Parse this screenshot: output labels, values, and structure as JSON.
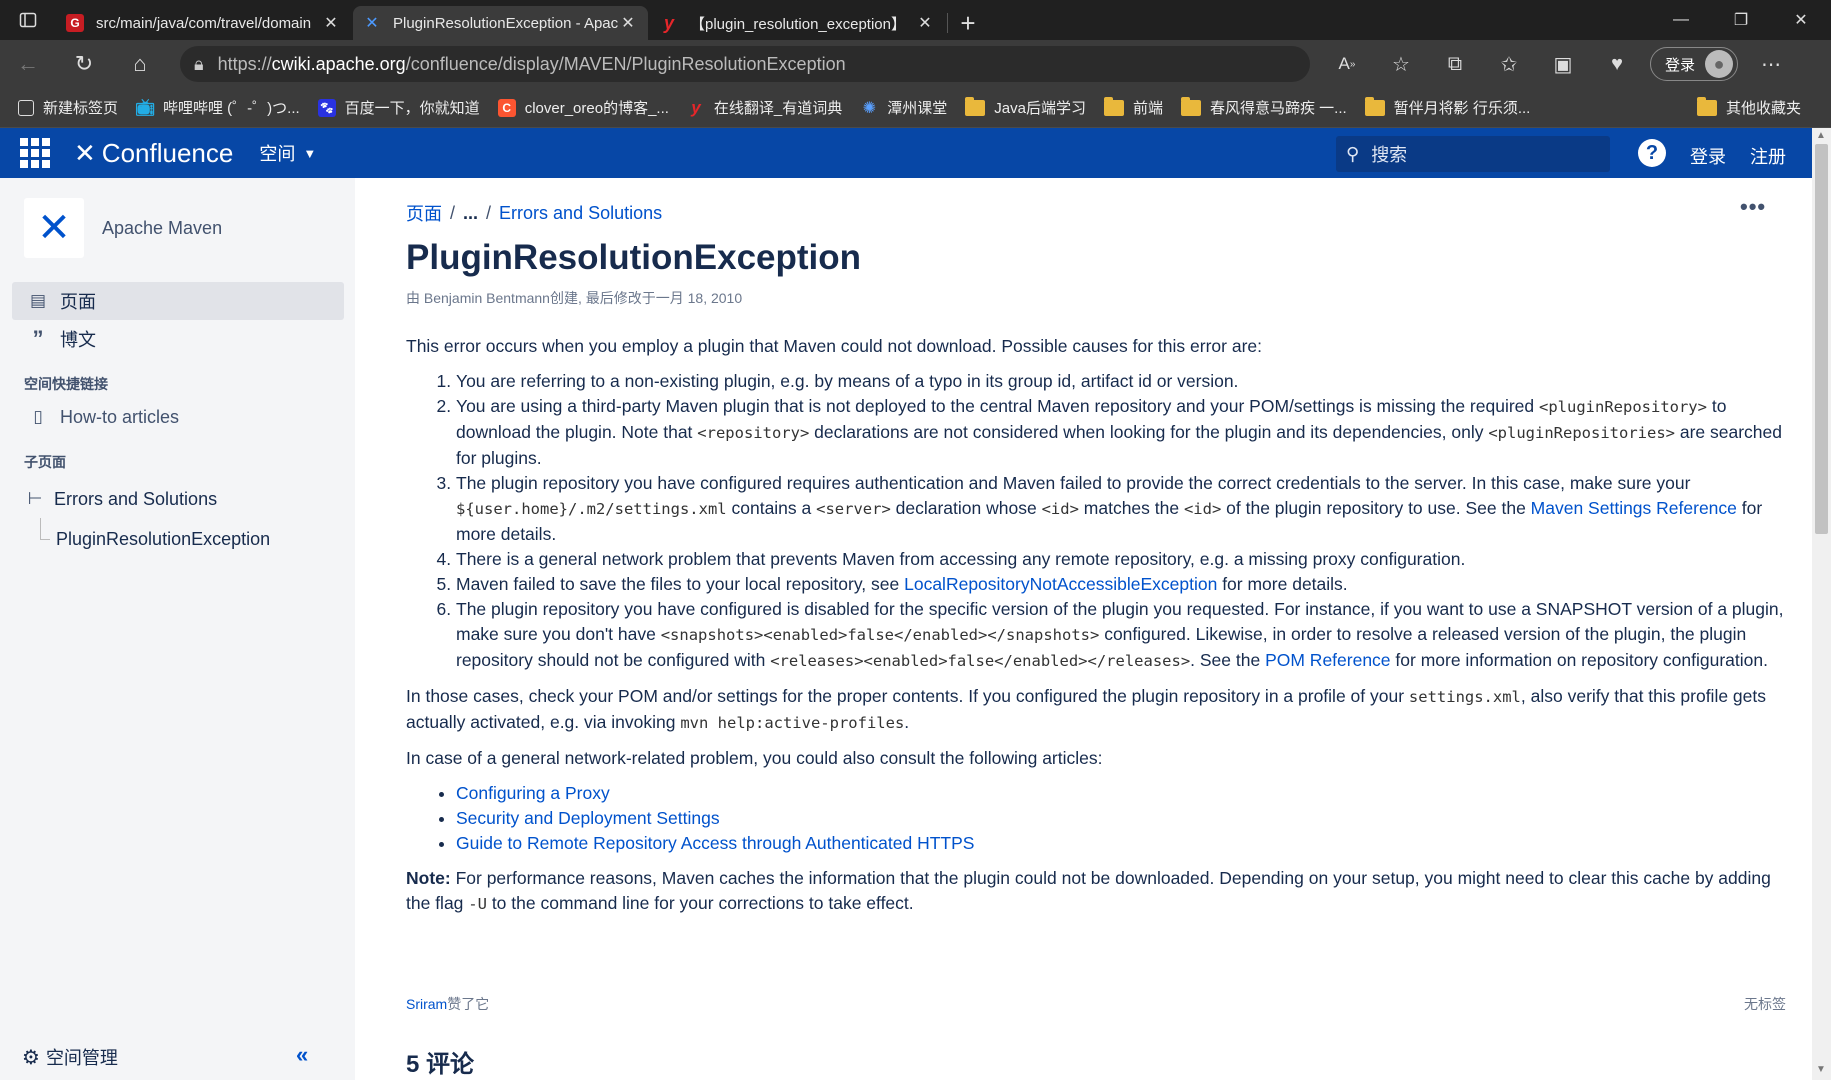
{
  "browser": {
    "tabs": [
      {
        "title": "src/main/java/com/travel/domain",
        "favicon": "G"
      },
      {
        "title": "PluginResolutionException - Apache",
        "favicon": "X"
      },
      {
        "title": "【plugin_resolution_exception】",
        "favicon": "y"
      }
    ],
    "url_prefix": "https://",
    "url_host": "cwiki.apache.org",
    "url_path": "/confluence/display/MAVEN/PluginResolutionException",
    "login_label": "登录",
    "bookmarks": [
      {
        "label": "新建标签页",
        "icon": "newtab-icon"
      },
      {
        "label": "哔哩哔哩 (゜-゜)つ...",
        "icon": "bilibili-icon"
      },
      {
        "label": "百度一下，你就知道",
        "icon": "baidu-icon"
      },
      {
        "label": "clover_oreo的博客_...",
        "icon": "csdn-icon"
      },
      {
        "label": "在线翻译_有道词典",
        "icon": "youdao-icon"
      },
      {
        "label": "潭州课堂",
        "icon": "tanzhou-icon"
      },
      {
        "label": "Java后端学习",
        "icon": "folder-icon"
      },
      {
        "label": "前端",
        "icon": "folder-icon"
      },
      {
        "label": "春风得意马蹄疾 一...",
        "icon": "folder-icon"
      },
      {
        "label": "暂伴月将影 行乐须...",
        "icon": "folder-icon"
      }
    ],
    "other_bookmarks": "其他收藏夹"
  },
  "header": {
    "logo": "Confluence",
    "space_menu": "空间",
    "search_placeholder": "搜索",
    "help": "?",
    "login": "登录",
    "register": "注册"
  },
  "sidebar": {
    "space_name": "Apache Maven",
    "items": [
      {
        "label": "页面"
      },
      {
        "label": "博文"
      }
    ],
    "shortcuts_heading": "空间快捷链接",
    "shortcut": "How-to articles",
    "children_heading": "子页面",
    "tree_parent": "Errors and Solutions",
    "tree_child": "PluginResolutionException",
    "manage": "空间管理"
  },
  "page": {
    "breadcrumb_root": "页面",
    "breadcrumb_ellipsis": "...",
    "breadcrumb_parent": "Errors and Solutions",
    "title": "PluginResolutionException",
    "meta": "由 Benjamin Bentmann创建, 最后修改于一月 18, 2010",
    "intro": "This error occurs when you employ a plugin that Maven could not download. Possible causes for this error are:",
    "causes": {
      "c1": "You are referring to a non-existing plugin, e.g. by means of a typo in its group id, artifact id or version.",
      "c2a": "You are using a third-party Maven plugin that is not deployed to the central Maven repository and your POM/settings is missing the required ",
      "c2code1": "<pluginRepository>",
      "c2b": " to download the plugin. Note that ",
      "c2code2": "<repository>",
      "c2c": " declarations are not considered when looking for the plugin and its dependencies, only ",
      "c2code3": "<pluginRepositories>",
      "c2d": " are searched for plugins.",
      "c3a": "The plugin repository you have configured requires authentication and Maven failed to provide the correct credentials to the server. In this case, make sure your ",
      "c3code1": "${user.home}/.m2/settings.xml",
      "c3b": " contains a ",
      "c3code2": "<server>",
      "c3c": " declaration whose ",
      "c3code3": "<id>",
      "c3d": " matches the ",
      "c3code4": "<id>",
      "c3e": " of the plugin repository to use. See the ",
      "c3link": "Maven Settings Reference",
      "c3f": " for more details.",
      "c4": "There is a general network problem that prevents Maven from accessing any remote repository, e.g. a missing proxy configuration.",
      "c5a": "Maven failed to save the files to your local repository, see ",
      "c5link": "LocalRepositoryNotAccessibleException",
      "c5b": " for more details.",
      "c6a": "The plugin repository you have configured is disabled for the specific version of the plugin you requested. For instance, if you want to use a SNAPSHOT version of a plugin, make sure you don't have ",
      "c6code1": "<snapshots><enabled>false</enabled></snapshots>",
      "c6b": " configured. Likewise, in order to resolve a released version of the plugin, the plugin repository should not be configured with ",
      "c6code2": "<releases><enabled>false</enabled></releases>",
      "c6c": ". See the ",
      "c6link": "POM Reference",
      "c6d": " for more information on repository configuration."
    },
    "check_a": "In those cases, check your POM and/or settings for the proper contents. If you configured the plugin repository in a profile of your ",
    "check_code1": "settings.xml",
    "check_b": ", also verify that this profile gets actually activated, e.g. via invoking ",
    "check_code2": "mvn help:active-profiles",
    "check_c": ".",
    "network_intro": "In case of a general network-related problem, you could also consult the following articles:",
    "articles": [
      "Configuring a Proxy",
      "Security and Deployment Settings",
      "Guide to Remote Repository Access through Authenticated HTTPS"
    ],
    "note_label": "Note:",
    "note_a": " For performance reasons, Maven caches the information that the plugin could not be downloaded. Depending on your setup, you might need to clear this cache by adding the flag ",
    "note_code": "-U",
    "note_b": " to the command line for your corrections to take effect.",
    "likes_user": "Sriram",
    "likes_suffix": "赞了它",
    "no_labels": "无标签",
    "comments_title": "5 评论"
  },
  "colors": {
    "header_bg": "#0747a6",
    "link": "#0052cc",
    "sidebar_bg": "#f4f5f7"
  }
}
